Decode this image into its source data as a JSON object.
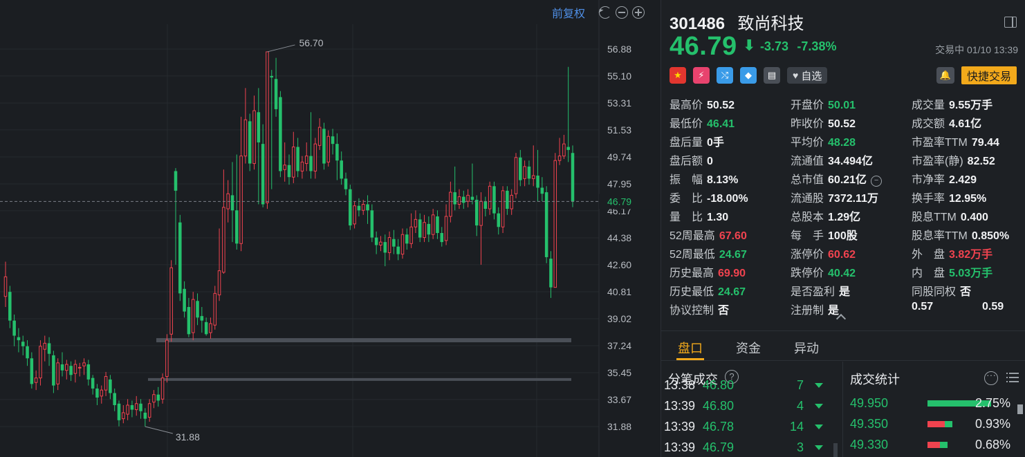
{
  "chart": {
    "adjust_label": "前复权",
    "peak_label": "56.70",
    "trough_label": "31.88",
    "current_label": "46.79",
    "ticks": [
      "56.88",
      "55.10",
      "53.31",
      "51.53",
      "49.74",
      "47.95",
      "46.17",
      "44.38",
      "42.60",
      "40.81",
      "39.02",
      "37.24",
      "35.45",
      "33.67",
      "31.88"
    ],
    "tick_vals": [
      56.88,
      55.1,
      53.31,
      51.53,
      49.74,
      47.95,
      46.17,
      44.38,
      42.6,
      40.81,
      39.02,
      37.24,
      35.45,
      33.67,
      31.88
    ],
    "current_price": 46.79,
    "support_levels": [
      37.6,
      35.0
    ],
    "candles": [
      [
        40.5,
        41.8,
        39.8,
        42.8
      ],
      [
        40.8,
        38.9,
        38.4,
        41.2
      ],
      [
        38.9,
        37.9,
        37.2,
        39.3
      ],
      [
        37.8,
        37.6,
        36.8,
        38.4
      ],
      [
        37.5,
        37.2,
        36.6,
        37.9
      ],
      [
        37.2,
        36.4,
        35.9,
        37.6
      ],
      [
        36.4,
        34.7,
        34.4,
        36.8
      ],
      [
        34.8,
        35.1,
        34.3,
        35.6
      ],
      [
        35.1,
        37.2,
        34.6,
        37.6
      ],
      [
        37.0,
        37.4,
        36.2,
        37.9
      ],
      [
        37.4,
        36.7,
        35.9,
        37.8
      ],
      [
        36.6,
        34.6,
        34.1,
        36.9
      ],
      [
        34.7,
        36.1,
        34.3,
        36.4
      ],
      [
        36.0,
        35.6,
        35.2,
        36.8
      ],
      [
        35.6,
        36.0,
        35.0,
        36.3
      ],
      [
        35.9,
        35.3,
        34.9,
        36.2
      ],
      [
        35.4,
        36.0,
        34.8,
        36.3
      ],
      [
        35.8,
        35.8,
        35.2,
        36.1
      ],
      [
        35.9,
        36.1,
        35.3,
        36.4
      ],
      [
        36.0,
        35.0,
        34.6,
        36.3
      ],
      [
        35.1,
        34.4,
        34.0,
        35.3
      ],
      [
        34.4,
        33.8,
        33.3,
        34.7
      ],
      [
        33.9,
        34.3,
        33.4,
        34.6
      ],
      [
        34.3,
        35.2,
        33.9,
        35.5
      ],
      [
        35.0,
        34.1,
        33.7,
        35.3
      ],
      [
        34.1,
        33.3,
        32.9,
        34.4
      ],
      [
        33.4,
        32.3,
        31.9,
        33.6
      ],
      [
        32.4,
        32.8,
        32.1,
        33.3
      ],
      [
        32.7,
        33.3,
        32.3,
        33.7
      ],
      [
        33.3,
        33.0,
        32.5,
        33.6
      ],
      [
        33.0,
        33.4,
        32.6,
        33.9
      ],
      [
        33.4,
        32.9,
        32.4,
        33.7
      ],
      [
        32.8,
        32.4,
        31.88,
        33.1
      ],
      [
        32.5,
        33.4,
        32.2,
        33.7
      ],
      [
        33.5,
        34.0,
        33.1,
        34.3
      ],
      [
        34.0,
        33.6,
        33.2,
        34.5
      ],
      [
        33.7,
        35.1,
        33.4,
        35.4
      ],
      [
        35.2,
        37.6,
        34.8,
        38.0
      ],
      [
        38.0,
        42.4,
        37.5,
        42.9
      ],
      [
        48.8,
        47.5,
        42.6,
        49.0
      ],
      [
        45.4,
        40.7,
        40.2,
        45.9
      ],
      [
        41.0,
        39.5,
        39.1,
        41.5
      ],
      [
        39.8,
        38.0,
        37.8,
        40.4
      ],
      [
        38.1,
        40.3,
        37.6,
        40.8
      ],
      [
        40.2,
        39.1,
        38.6,
        40.7
      ],
      [
        39.2,
        38.9,
        38.1,
        39.8
      ],
      [
        38.8,
        38.0,
        37.9,
        39.1
      ],
      [
        38.1,
        38.7,
        37.7,
        39.1
      ],
      [
        38.6,
        40.7,
        38.3,
        41.2
      ],
      [
        40.6,
        42.2,
        40.2,
        45.0
      ],
      [
        42.1,
        46.4,
        42.0,
        48.9
      ],
      [
        46.3,
        47.3,
        45.4,
        48.2
      ],
      [
        47.2,
        46.2,
        44.1,
        49.4
      ],
      [
        46.2,
        44.0,
        43.6,
        49.9
      ],
      [
        44.0,
        49.8,
        43.5,
        52.4
      ],
      [
        49.8,
        52.2,
        49.3,
        54.3
      ],
      [
        52.1,
        49.3,
        48.8,
        52.6
      ],
      [
        49.3,
        52.8,
        48.9,
        53.8
      ],
      [
        52.7,
        50.7,
        46.6,
        54.3
      ],
      [
        50.6,
        46.6,
        46.4,
        51.9
      ],
      [
        46.7,
        56.7,
        46.3,
        56.7
      ],
      [
        55.1,
        55.0,
        47.6,
        55.5
      ],
      [
        54.9,
        52.9,
        52.4,
        56.3
      ],
      [
        53.7,
        48.8,
        48.4,
        54.1
      ],
      [
        48.9,
        49.2,
        48.1,
        50.7
      ],
      [
        49.2,
        48.4,
        47.9,
        49.9
      ],
      [
        48.4,
        50.4,
        48.0,
        51.4
      ],
      [
        50.4,
        48.8,
        48.4,
        51.0
      ],
      [
        48.8,
        49.4,
        48.3,
        49.8
      ],
      [
        49.3,
        49.8,
        48.8,
        50.7
      ],
      [
        49.8,
        48.8,
        48.3,
        52.7
      ],
      [
        48.8,
        50.6,
        48.3,
        51.0
      ],
      [
        50.5,
        51.7,
        50.2,
        52.3
      ],
      [
        51.6,
        49.3,
        48.9,
        52.0
      ],
      [
        49.4,
        51.1,
        49.1,
        51.5
      ],
      [
        51.1,
        50.6,
        49.9,
        51.6
      ],
      [
        50.6,
        49.5,
        48.2,
        51.3
      ],
      [
        49.5,
        48.3,
        47.9,
        50.1
      ],
      [
        48.3,
        47.6,
        47.2,
        48.7
      ],
      [
        47.6,
        45.2,
        44.9,
        47.9
      ],
      [
        45.3,
        46.5,
        45.0,
        46.8
      ],
      [
        46.5,
        46.2,
        45.8,
        47.0
      ],
      [
        46.2,
        46.6,
        45.9,
        46.9
      ],
      [
        46.6,
        46.2,
        45.3,
        47.2
      ],
      [
        46.2,
        44.4,
        44.1,
        46.6
      ],
      [
        44.4,
        43.9,
        43.3,
        44.8
      ],
      [
        43.9,
        44.1,
        43.5,
        44.5
      ],
      [
        44.1,
        43.4,
        42.5,
        44.6
      ],
      [
        43.4,
        44.4,
        42.9,
        44.8
      ],
      [
        44.3,
        43.8,
        43.3,
        44.9
      ],
      [
        43.8,
        43.3,
        42.9,
        44.3
      ],
      [
        43.3,
        44.6,
        43.0,
        45.0
      ],
      [
        44.6,
        44.0,
        43.6,
        45.0
      ],
      [
        44.0,
        45.1,
        43.7,
        46.0
      ],
      [
        45.1,
        45.6,
        44.7,
        46.2
      ],
      [
        45.6,
        44.4,
        44.1,
        46.0
      ],
      [
        44.4,
        45.4,
        44.1,
        45.9
      ],
      [
        45.3,
        44.6,
        44.1,
        45.8
      ],
      [
        44.6,
        45.9,
        44.3,
        46.3
      ],
      [
        45.8,
        44.7,
        44.3,
        46.2
      ],
      [
        44.7,
        44.1,
        43.8,
        45.1
      ],
      [
        44.2,
        45.8,
        43.9,
        46.6
      ],
      [
        45.8,
        47.4,
        45.4,
        48.1
      ],
      [
        47.4,
        46.6,
        46.2,
        49.1
      ],
      [
        46.6,
        47.1,
        46.3,
        47.6
      ],
      [
        47.1,
        46.7,
        46.3,
        47.5
      ],
      [
        46.8,
        47.2,
        46.4,
        47.6
      ],
      [
        47.1,
        46.9,
        46.6,
        49.3
      ],
      [
        46.9,
        45.2,
        44.5,
        47.2
      ],
      [
        45.2,
        46.8,
        42.6,
        47.4
      ],
      [
        46.8,
        46.3,
        45.8,
        47.1
      ],
      [
        46.3,
        47.8,
        45.9,
        48.1
      ],
      [
        47.8,
        46.0,
        45.6,
        48.1
      ],
      [
        46.0,
        45.1,
        44.6,
        46.4
      ],
      [
        45.1,
        47.5,
        44.7,
        47.8
      ],
      [
        47.5,
        46.3,
        45.9,
        47.8
      ],
      [
        46.3,
        47.2,
        45.9,
        47.6
      ],
      [
        47.3,
        49.7,
        47.0,
        50.0
      ],
      [
        49.7,
        48.2,
        47.8,
        50.2
      ],
      [
        48.3,
        49.1,
        47.8,
        49.5
      ],
      [
        49.1,
        48.3,
        47.9,
        49.5
      ],
      [
        48.3,
        48.5,
        47.8,
        50.5
      ],
      [
        48.5,
        47.7,
        46.8,
        50.2
      ],
      [
        47.7,
        47.3,
        46.8,
        48.4
      ],
      [
        47.4,
        43.1,
        42.7,
        47.8
      ],
      [
        43.0,
        41.1,
        40.4,
        43.5
      ],
      [
        41.1,
        49.5,
        41.1,
        50.0
      ],
      [
        49.5,
        49.8,
        49.2,
        51.0
      ],
      [
        49.8,
        50.6,
        49.6,
        51.2
      ],
      [
        50.4,
        50.2,
        49.4,
        55.7
      ],
      [
        50.0,
        46.8,
        46.41,
        50.5
      ]
    ]
  },
  "header": {
    "code": "301486",
    "name": "致尚科技",
    "price": "46.79",
    "change": "-3.73",
    "change_pct": "-7.38%",
    "status": "交易中 01/10 13:39"
  },
  "icons": {
    "watch_label": "自选",
    "quick_trade_label": "快捷交易"
  },
  "stats": [
    [
      {
        "k": "最高价",
        "v": "50.52",
        "c": "white"
      },
      {
        "k": "开盘价",
        "v": "50.01",
        "c": "green"
      },
      {
        "k": "成交量",
        "v": "9.55万手",
        "c": "white"
      }
    ],
    [
      {
        "k": "最低价",
        "v": "46.41",
        "c": "green"
      },
      {
        "k": "昨收价",
        "v": "50.52",
        "c": "white"
      },
      {
        "k": "成交额",
        "v": "4.61亿",
        "c": "white"
      }
    ],
    [
      {
        "k": "盘后量",
        "v": "0手",
        "c": "white"
      },
      {
        "k": "平均价",
        "v": "48.28",
        "c": "green"
      },
      {
        "k": "市盈率TTM",
        "v": "79.44",
        "c": "white"
      }
    ],
    [
      {
        "k": "盘后额",
        "v": "0",
        "c": "white"
      },
      {
        "k": "流通值",
        "v": "34.494亿",
        "c": "white"
      },
      {
        "k": "市盈率(静)",
        "v": "82.52",
        "c": "white"
      }
    ],
    [
      {
        "k": "振　幅",
        "v": "8.13%",
        "c": "white"
      },
      {
        "k": "总市值",
        "v": "60.21亿",
        "c": "white"
      },
      {
        "k": "市净率",
        "v": "2.429",
        "c": "white"
      }
    ],
    [
      {
        "k": "委　比",
        "v": "-18.00%",
        "c": "white"
      },
      {
        "k": "流通股",
        "v": "7372.11万",
        "c": "white"
      },
      {
        "k": "换手率",
        "v": "12.95%",
        "c": "white"
      }
    ],
    [
      {
        "k": "量　比",
        "v": "1.30",
        "c": "white"
      },
      {
        "k": "总股本",
        "v": "1.29亿",
        "c": "white"
      },
      {
        "k": "股息TTM",
        "v": "0.400",
        "c": "white"
      }
    ],
    [
      {
        "k": "52周最高",
        "v": "67.60",
        "c": "red"
      },
      {
        "k": "每　手",
        "v": "100股",
        "c": "white"
      },
      {
        "k": "股息率TTM",
        "v": "0.850%",
        "c": "white"
      }
    ],
    [
      {
        "k": "52周最低",
        "v": "24.67",
        "c": "green"
      },
      {
        "k": "涨停价",
        "v": "60.62",
        "c": "red"
      },
      {
        "k": "外　盘",
        "v": "3.82万手",
        "c": "red"
      }
    ],
    [
      {
        "k": "历史最高",
        "v": "69.90",
        "c": "red"
      },
      {
        "k": "跌停价",
        "v": "40.42",
        "c": "green"
      },
      {
        "k": "内　盘",
        "v": "5.03万手",
        "c": "green"
      }
    ],
    [
      {
        "k": "历史最低",
        "v": "24.67",
        "c": "green"
      },
      {
        "k": "是否盈利",
        "v": "是",
        "c": "white"
      },
      {
        "k": "同股同权",
        "v": "否",
        "c": "white"
      }
    ],
    [
      {
        "k": "协议控制",
        "v": "否",
        "c": "white"
      },
      {
        "k": "注册制",
        "v": "是",
        "c": "white"
      },
      {
        "k": "",
        "v": "",
        "c": "white"
      }
    ]
  ],
  "bottom_vals": [
    "0.57",
    "0.59"
  ],
  "tabs": [
    "盘口",
    "资金",
    "异动"
  ],
  "ticks_panel": {
    "title": "分笔成交",
    "rows": [
      {
        "time": "13:38",
        "price": "46.80",
        "vol": "7"
      },
      {
        "time": "13:39",
        "price": "46.80",
        "vol": "4"
      },
      {
        "time": "13:39",
        "price": "46.78",
        "vol": "14"
      },
      {
        "time": "13:39",
        "price": "46.79",
        "vol": "3"
      }
    ]
  },
  "volume_stats": {
    "title": "成交统计",
    "rows": [
      {
        "price": "49.950",
        "pct": "2.75%",
        "green": 1.0,
        "red": 0.0
      },
      {
        "price": "49.350",
        "pct": "0.93%",
        "green": 0.12,
        "red": 0.27
      },
      {
        "price": "49.330",
        "pct": "0.68%",
        "green": 0.12,
        "red": 0.2
      }
    ]
  }
}
